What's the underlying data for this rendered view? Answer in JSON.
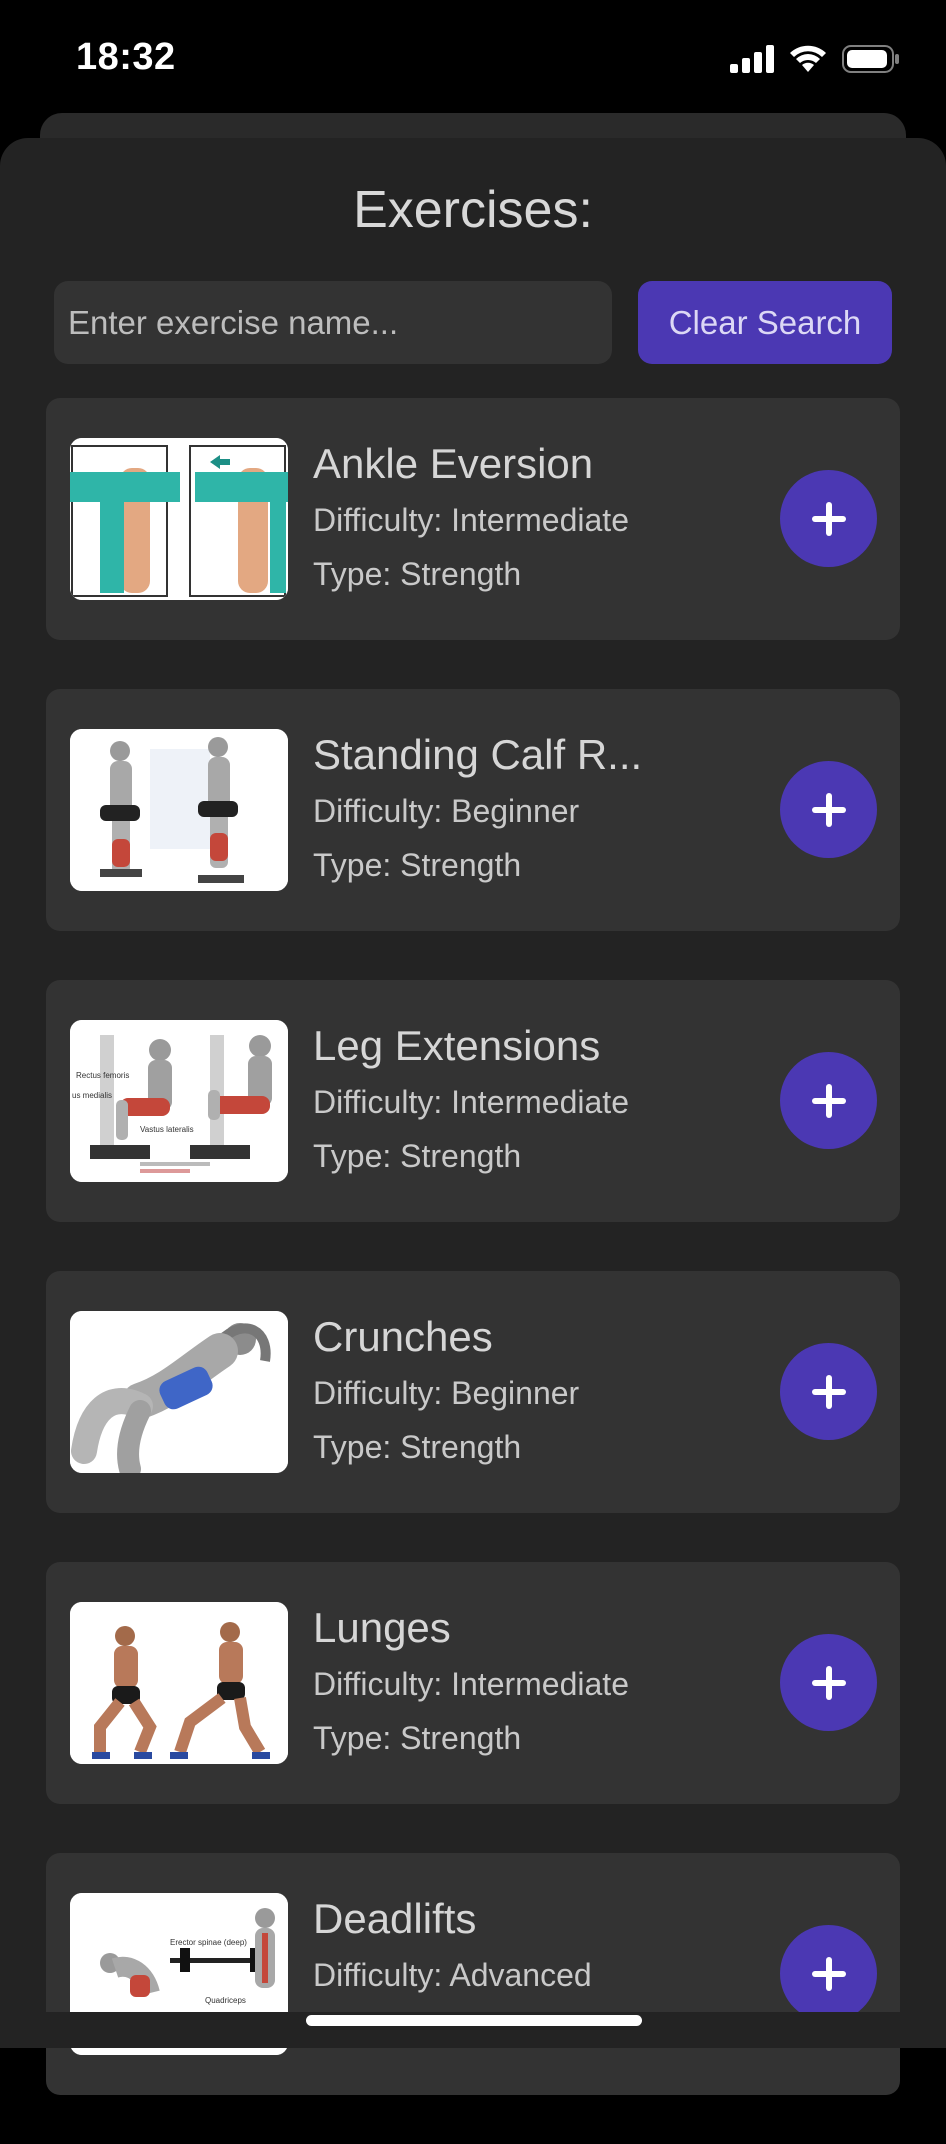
{
  "status_bar": {
    "time": "18:32"
  },
  "sheet": {
    "title": "Exercises:"
  },
  "search": {
    "placeholder": "Enter exercise name...",
    "value": "",
    "clear_label": "Clear Search"
  },
  "exercises": [
    {
      "name": "Ankle Eversion",
      "difficulty": "Difficulty: Intermediate",
      "type": "Type: Strength"
    },
    {
      "name": "Standing Calf R...",
      "difficulty": "Difficulty: Beginner",
      "type": "Type: Strength"
    },
    {
      "name": "Leg Extensions",
      "difficulty": "Difficulty: Intermediate",
      "type": "Type: Strength"
    },
    {
      "name": "Crunches",
      "difficulty": "Difficulty: Beginner",
      "type": "Type: Strength"
    },
    {
      "name": "Lunges",
      "difficulty": "Difficulty: Intermediate",
      "type": "Type: Strength"
    },
    {
      "name": "Deadlifts",
      "difficulty": "Difficulty: Advanced",
      "type": ""
    }
  ],
  "icons": {
    "add": "plus-icon",
    "signal": "cellular-signal-icon",
    "wifi": "wifi-icon",
    "battery": "battery-icon"
  },
  "colors": {
    "accent": "#4b38b3",
    "card": "#333333",
    "sheet": "#232323"
  }
}
